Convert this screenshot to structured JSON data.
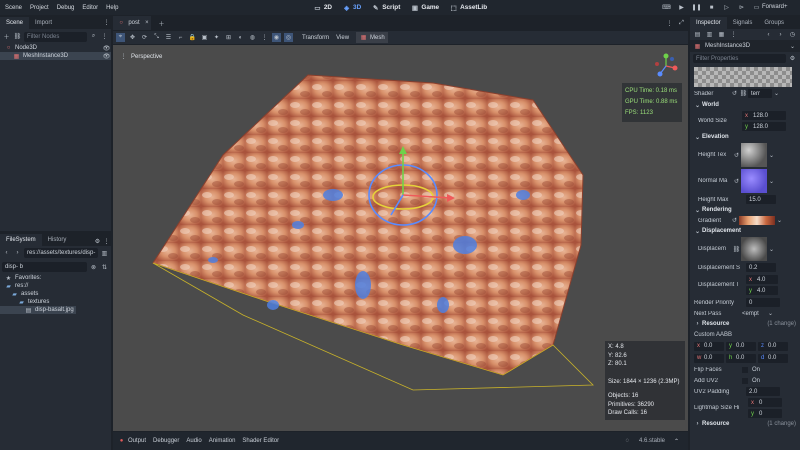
{
  "menu": [
    "Scene",
    "Project",
    "Debug",
    "Editor",
    "Help"
  ],
  "workspaces": [
    {
      "label": "2D",
      "icon": "2d-icon"
    },
    {
      "label": "3D",
      "icon": "3d-icon"
    },
    {
      "label": "Script",
      "icon": "script-icon"
    },
    {
      "label": "Game",
      "icon": "game-icon"
    },
    {
      "label": "AssetLib",
      "icon": "assetlib-icon"
    }
  ],
  "renderer": "Forward+",
  "left_tabs": [
    "Scene",
    "Import"
  ],
  "scene_filter_placeholder": "Filter Nodes",
  "scene_tree": [
    "Node3D",
    "MeshInstance3D"
  ],
  "fs_tabs": [
    "FileSystem",
    "History"
  ],
  "fs_path": "res://assets/textures/disp-",
  "fs_filter": "disp- b",
  "fs_tree": [
    "Favorites:",
    "res://",
    "assets",
    "textures",
    "disp-basalt.jpg"
  ],
  "scene_tab": "post",
  "vp_toolbar": {
    "transform": "Transform",
    "view": "View",
    "mesh": "Mesh"
  },
  "perspective": "Perspective",
  "stats": {
    "cpu": "CPU Time: 0.18 ms",
    "gpu": "GPU Time: 0.88 ms",
    "fps": "FPS: 1123"
  },
  "info": {
    "x": "X: 4.8",
    "y": "Y: 82.6",
    "z": "Z: 80.1",
    "size": "Size: 1844 × 1236 (2.3MP)",
    "objects": "Objects: 16",
    "primitives": "Primitives: 36290",
    "draws": "Draw Calls: 16"
  },
  "bottom_tabs": [
    "Output",
    "Debugger",
    "Audio",
    "Animation",
    "Shader Editor"
  ],
  "version": "4.6.stable",
  "right_tabs": [
    "Inspector",
    "Signals",
    "Groups"
  ],
  "inspector_node": "MeshInstance3D",
  "filter_props": "Filter Properties",
  "shader": {
    "label": "Shader",
    "value": "terr"
  },
  "world": {
    "title": "World",
    "size_label": "World Size",
    "x": "128.0",
    "y": "128.0"
  },
  "elevation": {
    "title": "Elevation",
    "height_tex": "Height Tex",
    "normal_map": "Normal Ma",
    "height_max_label": "Height Max",
    "height_max": "15.0"
  },
  "rendering": {
    "title": "Rendering",
    "gradient": "Gradient"
  },
  "displacement": {
    "title": "Displacement",
    "map": "Displacem",
    "strength_label": "Displacement S",
    "strength": "0.2",
    "tiling_label": "Displacement T",
    "tx": "4.0",
    "ty": "4.0"
  },
  "render_priority": {
    "label": "Render Priority",
    "value": "0"
  },
  "next_pass": {
    "label": "Next Pass",
    "value": "<empt"
  },
  "resource": {
    "label": "Resource",
    "note": "(1 change)"
  },
  "custom_aabb": {
    "label": "Custom AABB",
    "x": "0.0",
    "y": "0.0",
    "z": "0.0",
    "w": "0.0",
    "h": "0.0",
    "d": "0.0"
  },
  "flip_faces": {
    "label": "Flip Faces",
    "value": "On"
  },
  "add_uv2": {
    "label": "Add UV2",
    "value": "On"
  },
  "uv2_padding": {
    "label": "UV2 Padding",
    "value": "2.0"
  },
  "lightmap": {
    "label": "Lightmap Size Hi",
    "x": "0",
    "y": "0"
  },
  "resource2": {
    "label": "Resource",
    "note": "(1 change)"
  }
}
